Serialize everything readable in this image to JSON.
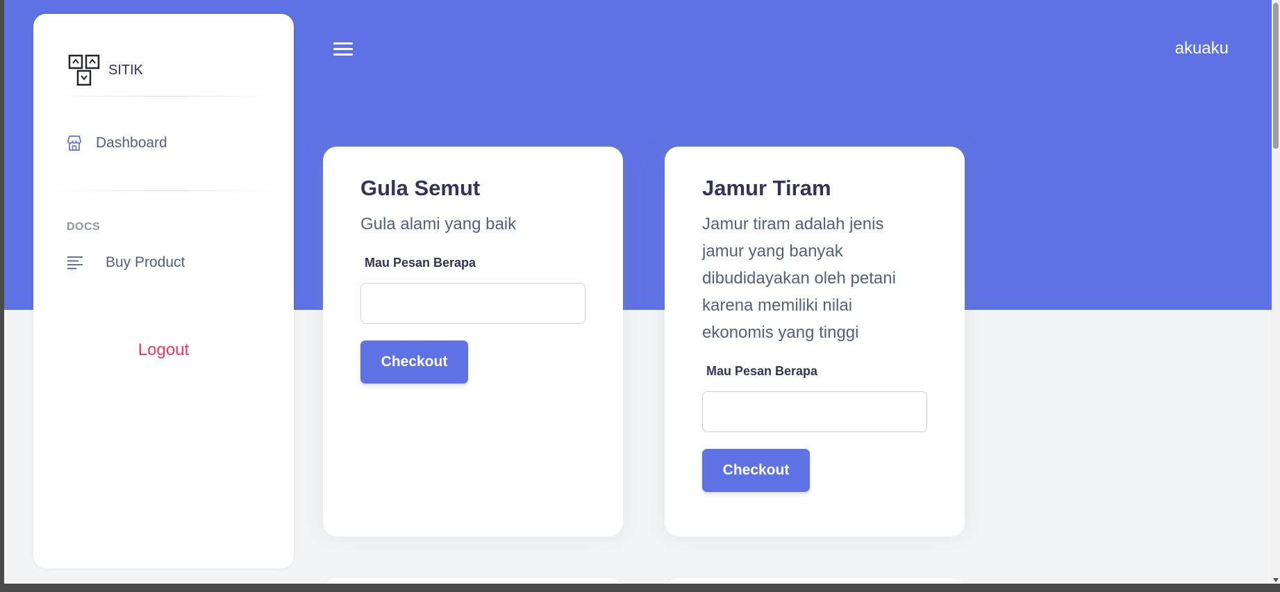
{
  "sidebar": {
    "brand": "SITIK",
    "nav": [
      {
        "label": "Dashboard",
        "icon": "store-icon"
      }
    ],
    "docs_heading": "DOCS",
    "docs": [
      {
        "label": "Buy Product",
        "icon": "lines-icon"
      }
    ],
    "logout": "Logout"
  },
  "header": {
    "username": "akuaku"
  },
  "products": [
    {
      "title": "Gula Semut",
      "description": "Gula alami yang baik",
      "qty_label": "Mau Pesan Berapa",
      "qty_value": "",
      "button": "Checkout"
    },
    {
      "title": "Jamur Tiram",
      "description": "Jamur tiram adalah jenis jamur yang banyak dibudidayakan oleh petani karena memiliki nilai ekonomis yang tinggi",
      "qty_label": "Mau Pesan Berapa",
      "qty_value": "",
      "button": "Checkout"
    }
  ],
  "colors": {
    "primary": "#5e72e4",
    "danger": "#f5365c",
    "heading": "#32325d",
    "text": "#525f7f",
    "muted": "#8898aa"
  }
}
